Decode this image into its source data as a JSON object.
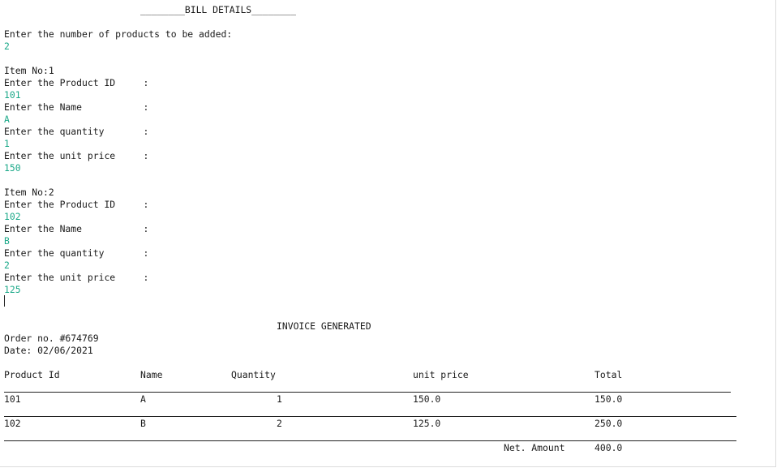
{
  "header": {
    "title": "________BILL DETAILS________"
  },
  "count_prompt": {
    "label": "Enter the number of products to be added:",
    "value": "2"
  },
  "items": [
    {
      "heading": "Item No:1",
      "fields": [
        {
          "label": "Enter the Product ID     :",
          "value": "101"
        },
        {
          "label": "Enter the Name           :",
          "value": "A"
        },
        {
          "label": "Enter the quantity       :",
          "value": "1"
        },
        {
          "label": "Enter the unit price     :",
          "value": "150"
        }
      ]
    },
    {
      "heading": "Item No:2",
      "fields": [
        {
          "label": "Enter the Product ID     :",
          "value": "102"
        },
        {
          "label": "Enter the Name           :",
          "value": "B"
        },
        {
          "label": "Enter the quantity       :",
          "value": "2"
        },
        {
          "label": "Enter the unit price     :",
          "value": "125"
        }
      ]
    }
  ],
  "invoice": {
    "title": "INVOICE GENERATED",
    "order": "Order no. #674769",
    "date": "Date: 02/06/2021",
    "columns": [
      "Product Id",
      "Name",
      "Quantity",
      "unit price",
      "Total"
    ],
    "rows": [
      [
        "101",
        "A",
        "1",
        "150.0",
        "150.0"
      ],
      [
        "102",
        "B",
        "2",
        "125.0",
        "250.0"
      ]
    ],
    "net_label": "Net. Amount",
    "net_value": "400.0"
  },
  "colors": {
    "input_text": "#1aa888",
    "output_text": "#1a1a1a"
  }
}
